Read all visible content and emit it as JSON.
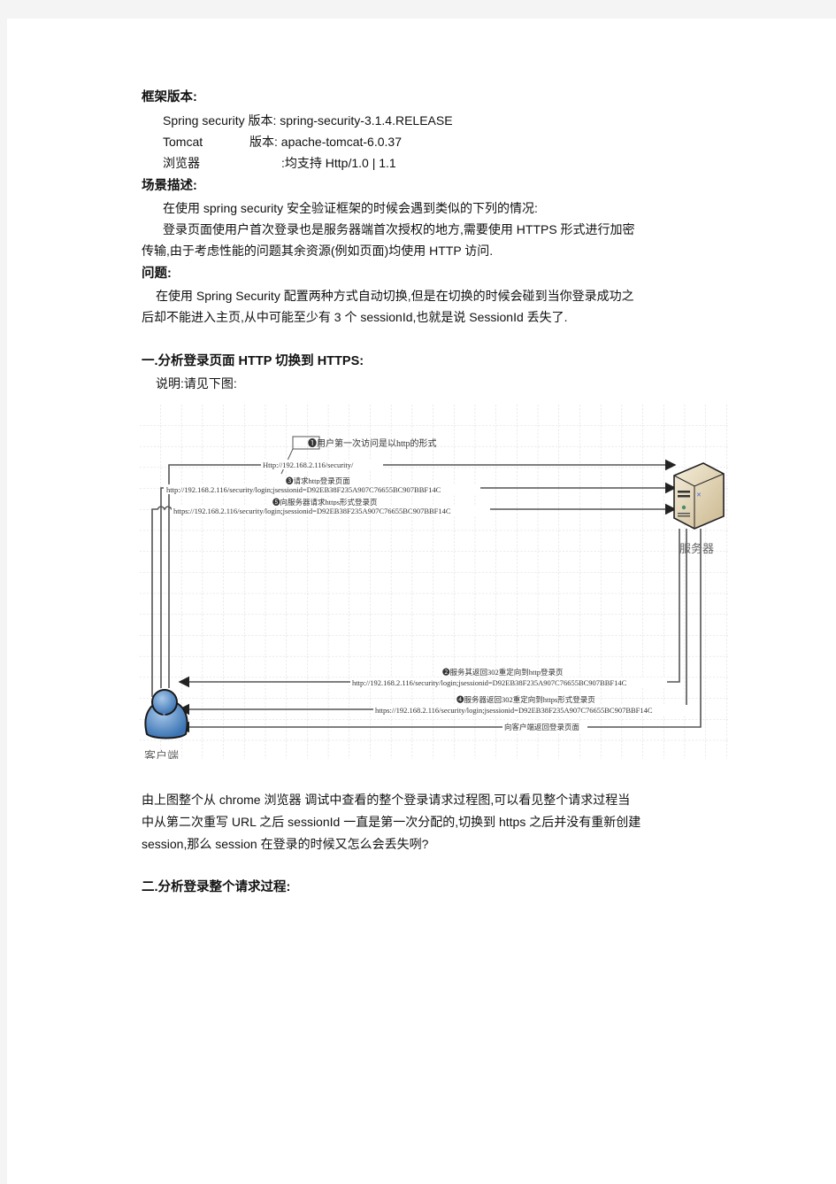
{
  "sections": {
    "framework": {
      "heading": "框架版本:",
      "rows": [
        {
          "name": "Spring  security",
          "label": "版本:",
          "value": "spring-security-3.1.4.RELEASE"
        },
        {
          "name": "Tomcat",
          "label": "版本:",
          "value": "apache-tomcat-6.0.37"
        },
        {
          "name": "浏览器",
          "label": ":均支持",
          "value": "Http/1.0  |  1.1"
        }
      ]
    },
    "scenario": {
      "heading": "场景描述:",
      "para1": "在使用 spring  security 安全验证框架的时候会遇到类似的下列的情况:",
      "para2_line1": "登录页面使用户首次登录也是服务器端首次授权的地方,需要使用  HTTPS  形式进行加密",
      "para2_line2": "传输,由于考虑性能的问题其余资源(例如页面)均使用 HTTP 访问."
    },
    "problem": {
      "heading": "问题:",
      "line1": "在使用  Spring   Security  配置两种方式自动切换,但是在切换的时候会碰到当你登录成功之",
      "line2": "后却不能进入主页,从中可能至少有 3 个 sessionId,也就是说 SessionId 丢失了."
    },
    "section1": {
      "heading": "一.分析登录页面 HTTP 切换到 HTTPS:",
      "note": "说明:请见下图:"
    },
    "analysis": {
      "line1": "由上图整个从 chrome   浏览器  调试中查看的整个登录请求过程图,可以看见整个请求过程当",
      "line2": "中从第二次重写 URL 之后 sessionId 一直是第一次分配的,切换到 https 之后并没有重新创建",
      "line3": "session,那么 session 在登录的时候又怎么会丢失咧?"
    },
    "section2": {
      "heading": "二.分析登录整个请求过程:"
    }
  },
  "diagram": {
    "client_label": "客户端",
    "server_label": "服务器",
    "steps": [
      {
        "num": "❶",
        "caption": "用户第一次访问是以http的形式",
        "url": "Http://192.168.2.116/security/"
      },
      {
        "num": "❸",
        "caption": "请求http登录页面",
        "url": "http://192.168.2.116/security/login;jsessionid=D92EB38F235A907C76655BC907BBF14C"
      },
      {
        "num": "❺",
        "caption": "向服务器请求https形式登录页",
        "url": "https://192.168.2.116/security/login;jsessionid=D92EB38F235A907C76655BC907BBF14C"
      },
      {
        "num": "❷",
        "caption": "服务其返回302重定向到http登录页",
        "url": "http://192.168.2.116/security/login;jsessionid=D92EB38F235A907C76655BC907BBF14C"
      },
      {
        "num": "❹",
        "caption": "服务器返回302重定向到https形式登录页",
        "url": "https://192.168.2.116/security/login;jsessionid=D92EB38F235A907C76655BC907BBF14C"
      },
      {
        "num": "",
        "caption": "向客户端返回登录页面",
        "url": ""
      }
    ],
    "colors": {
      "grid": "#c8c8c8",
      "line": "#555555",
      "client": "#4a86c5",
      "server": "#e8dcc0"
    }
  }
}
